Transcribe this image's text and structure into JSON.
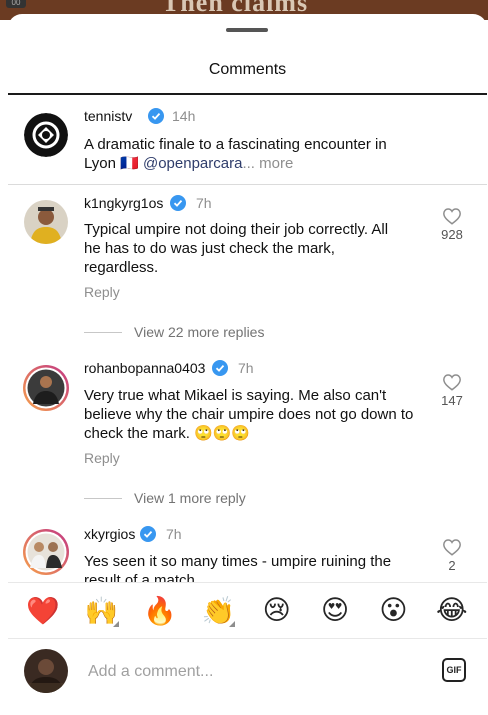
{
  "background": {
    "video_text": "Then claims",
    "corner_badge": "00"
  },
  "sheet": {
    "title": "Comments"
  },
  "caption": {
    "username": "tennistv",
    "verified": true,
    "time": "14h",
    "text_line1": "A dramatic finale to a fascinating encounter in",
    "text_line2_prefix": "Lyon 🇫🇷 ",
    "mention": "@openparcara",
    "more": "... more"
  },
  "comments": [
    {
      "username": "k1ngkyrg1os",
      "verified": true,
      "time": "7h",
      "text": "Typical umpire not doing their job correctly. All he has to do was just check the mark, regardless.",
      "likes": "928",
      "reply_label": "Reply",
      "view_replies": "View 22 more replies"
    },
    {
      "username": "rohanbopanna0403",
      "verified": true,
      "time": "7h",
      "text": "Very true what Mikael is saying. Me also can't believe why the chair umpire does not go down to check the mark. 🙄🙄🙄",
      "likes": "147",
      "reply_label": "Reply",
      "view_replies": "View 1 more reply"
    },
    {
      "username": "xkyrgios",
      "verified": true,
      "time": "7h",
      "text": "Yes seen it so many times - umpire ruining the result of a match",
      "likes": "2"
    }
  ],
  "emoji_bar": [
    "❤️",
    "🙌",
    "🔥",
    "👏",
    "😢",
    "😍",
    "😮",
    "😂"
  ],
  "composer": {
    "placeholder": "Add a comment...",
    "gif_label": "GIF"
  },
  "colors": {
    "verified_blue": "#3897f0",
    "story_ring_start": "#f7a34b",
    "story_ring_end": "#c13584"
  }
}
